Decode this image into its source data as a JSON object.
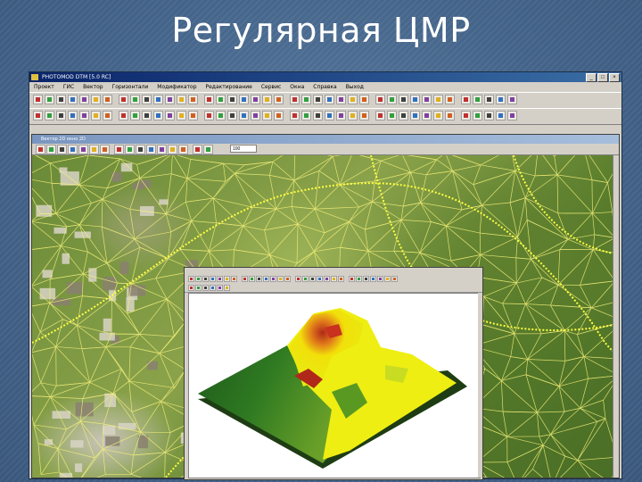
{
  "slide": {
    "title": "Регулярная ЦМР"
  },
  "app": {
    "title": "PHOTOMOD DTM [5.0 RC]",
    "menu": [
      "Проект",
      "ГИС",
      "Вектор",
      "Горизонтали",
      "Модификатор",
      "Редактирование",
      "Сервис",
      "Окна",
      "Справка",
      "Выход"
    ],
    "window_buttons": [
      "_",
      "□",
      "×"
    ]
  },
  "child_window": {
    "title": "Вектор 2D окно 2D",
    "zoom_value": "100"
  },
  "colors": {
    "slide_bg": "#4a6a90",
    "titlebar": "#0a246a",
    "tin_lines": "#f5f07a",
    "dem_high": "#c8321e",
    "dem_mid": "#f0e60a",
    "dem_low": "#2e6a1e"
  }
}
